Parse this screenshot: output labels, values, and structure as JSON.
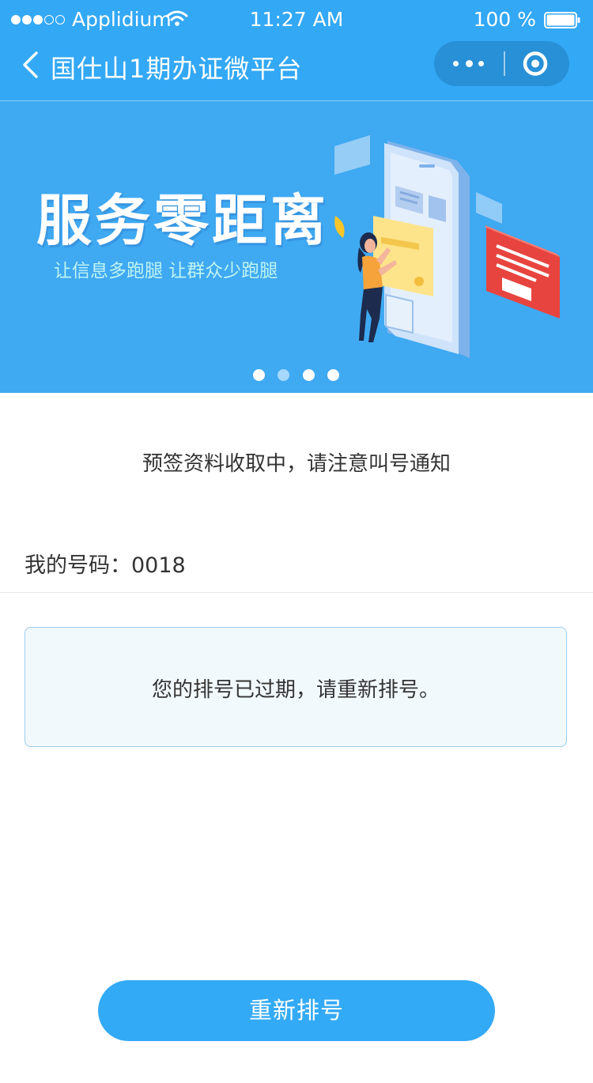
{
  "status_bar": {
    "carrier": "Applidium",
    "time": "11:27 AM",
    "battery": "100 %",
    "signal_dots_filled": 3,
    "signal_dots_total": 5,
    "battery_level": 1.0
  },
  "nav": {
    "title": "国仕山1期办证微平台",
    "back_icon": "chevron-left-icon",
    "more_icon": "more-dots-icon",
    "close_icon": "target-circle-icon"
  },
  "banner": {
    "slogan": "服务零距离",
    "tagline": "让信息多跑腿  让群众少跑腿",
    "slides_total": 4,
    "active_slide": 2
  },
  "main": {
    "status_message": "预签资料收取中，请注意叫号通知",
    "number_label": "我的号码：",
    "number_value": "0018",
    "notice": "您的排号已过期，请重新排号。"
  },
  "actions": {
    "requeue_label": "重新排号"
  },
  "colors": {
    "primary": "#33a8f5",
    "capsule": "#2890d6",
    "notice_bg": "#f2f9fd",
    "notice_border": "#9ccdec",
    "text": "#333333"
  }
}
